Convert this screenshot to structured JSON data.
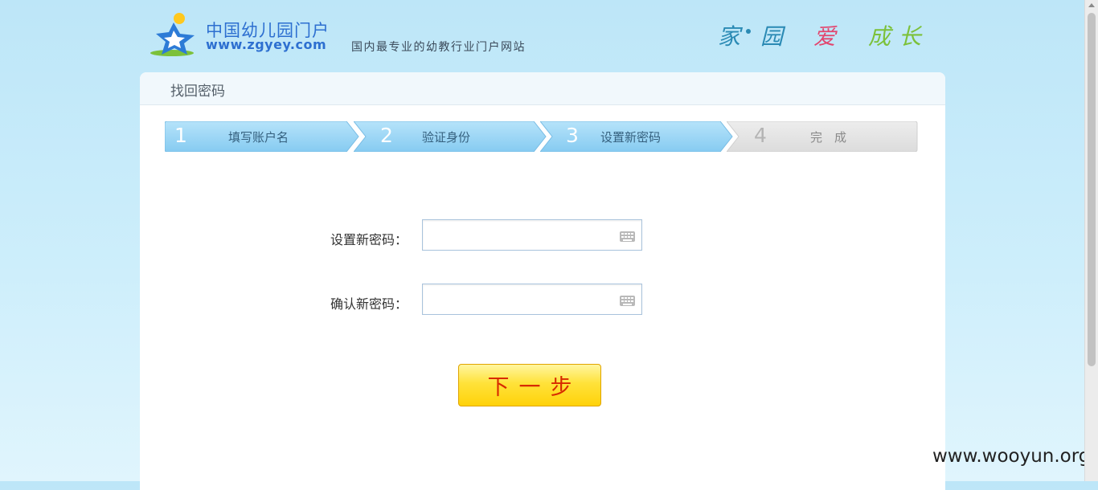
{
  "header": {
    "logo_title": "中国幼儿园门户",
    "logo_url": "www.zgyey.com",
    "slogan": "国内最专业的幼教行业门户网站",
    "motto": [
      "家",
      "园",
      "爱",
      "成",
      "长"
    ]
  },
  "panel": {
    "title": "找回密码"
  },
  "steps": [
    {
      "num": "1",
      "label": "填写账户名",
      "state": "done"
    },
    {
      "num": "2",
      "label": "验证身份",
      "state": "done"
    },
    {
      "num": "3",
      "label": "设置新密码",
      "state": "current"
    },
    {
      "num": "4",
      "label": "完　成",
      "state": "pending"
    }
  ],
  "form": {
    "new_password_label": "设置新密码：",
    "new_password_value": "",
    "confirm_password_label": "确认新密码：",
    "confirm_password_value": "",
    "next_button": "下一步"
  },
  "watermark": "www.wooyun.org",
  "colors": {
    "step_active": "#8fd0f3",
    "step_inactive": "#e3e3e3",
    "button": "#ffd20a",
    "button_text": "#d72a00"
  }
}
